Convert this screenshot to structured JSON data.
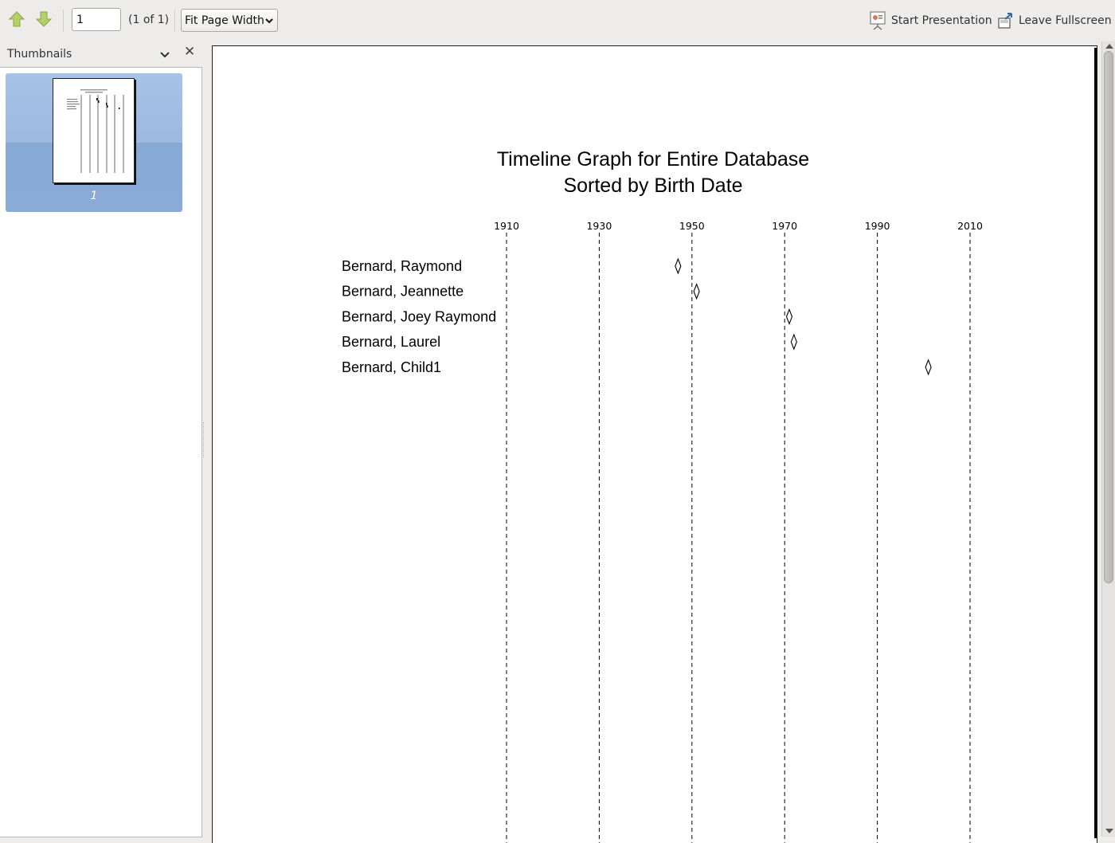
{
  "toolbar": {
    "prev_icon": "arrow-up-icon",
    "next_icon": "arrow-down-icon",
    "page_value": "1",
    "page_count": "(1 of 1)",
    "zoom_value": "Fit Page Width",
    "presentation_label": "Start Presentation",
    "presentation_icon": "presentation-icon",
    "fullscreen_label": "Leave Fullscreen",
    "fullscreen_icon": "leave-fullscreen-icon"
  },
  "sidebar": {
    "title": "Thumbnails",
    "thumbnails": [
      {
        "page_label": "1",
        "selected": true
      }
    ]
  },
  "colors": {
    "selection": "#8aabd8",
    "toolbar_bg": "#edeceb",
    "arrow_green": "#a8c24a"
  },
  "document": {
    "title": "Timeline Graph for Entire Database",
    "subtitle": "Sorted by Birth Date"
  },
  "chart_data": {
    "type": "timeline",
    "title": "Timeline Graph for Entire Database",
    "subtitle": "Sorted by Birth Date",
    "x_ticks": [
      1910,
      1930,
      1950,
      1970,
      1990,
      2010
    ],
    "xlim": [
      1910,
      2010
    ],
    "gridlines": "dashed vertical",
    "people": [
      {
        "name": "Bernard, Raymond",
        "birth_year": 1947
      },
      {
        "name": "Bernard, Jeannette",
        "birth_year": 1951
      },
      {
        "name": "Bernard, Joey Raymond",
        "birth_year": 1971
      },
      {
        "name": "Bernard, Laurel",
        "birth_year": 1972
      },
      {
        "name": "Bernard, Child1",
        "birth_year": 2001
      }
    ]
  }
}
